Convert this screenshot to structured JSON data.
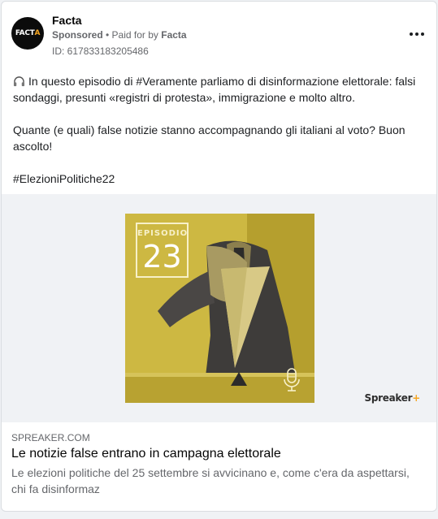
{
  "post": {
    "page_name": "Facta",
    "avatar_text": "FACT",
    "avatar_accent": "A",
    "sponsored_label": "Sponsored",
    "separator": " • ",
    "paid_for_prefix": "Paid for by ",
    "paid_for_name": "Facta",
    "ad_id": "ID: 617833183205486",
    "more_icon": "more-options-icon"
  },
  "body": {
    "icon": "headphones-icon",
    "paragraph_1": "In questo episodio di #Veramente parliamo di disinformazione elettorale: falsi sondaggi, presunti «registri di protesta», immigrazione e molto altro.",
    "paragraph_2": "Quante (e quali) false notizie stanno accompagnando gli italiani al voto? Buon ascolto!",
    "paragraph_3": "#ElezioniPolitiche22"
  },
  "media": {
    "episode_label": "EPISODIO",
    "episode_number": "23",
    "mic_icon": "microphone-icon",
    "logo_text": "Spreaker",
    "logo_plus": "+"
  },
  "link": {
    "domain": "SPREAKER.COM",
    "title": "Le notizie false entrano in campagna elettorale",
    "description": "Le elezioni politiche del 25 settembre si avvicinano e, come c'era da aspettarsi, chi fa disinformaz"
  },
  "colors": {
    "artwork_yellow": "#c9b33c",
    "text_primary": "#1c1e21",
    "text_secondary": "#65676b",
    "logo_accent": "#f5a623"
  }
}
